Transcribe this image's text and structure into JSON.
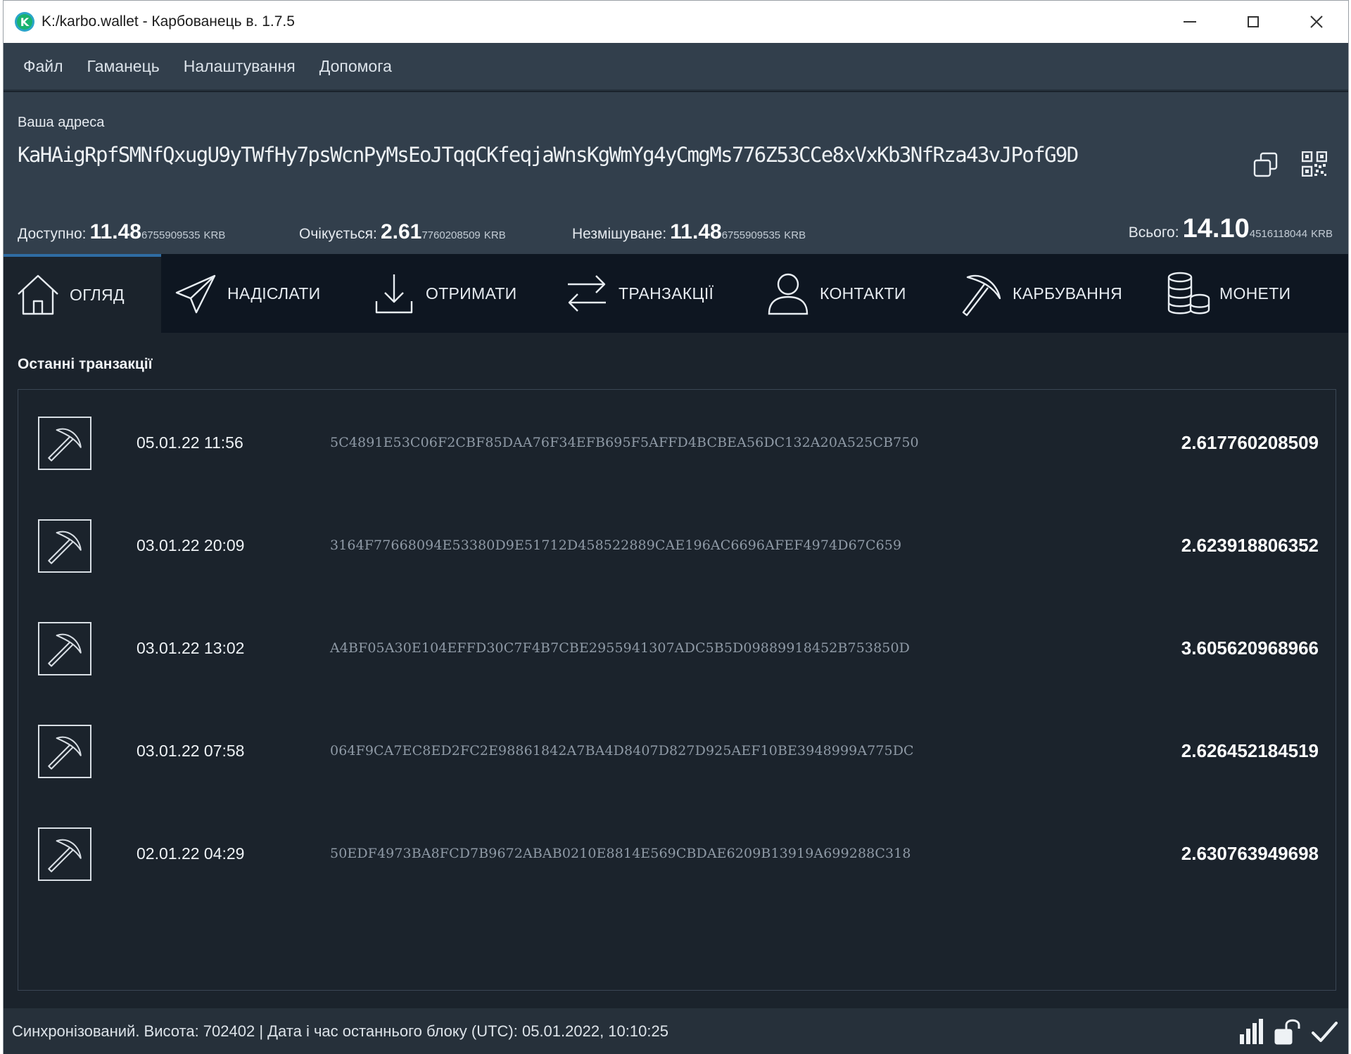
{
  "window": {
    "title": "K:/karbo.wallet - Карбованець в. 1.7.5",
    "logo_letter": "K"
  },
  "menu": [
    "Файл",
    "Гаманець",
    "Налаштування",
    "Допомога"
  ],
  "address": {
    "label": "Ваша адреса",
    "value": "KaHAigRpfSMNfQxugU9yTWfHy7psWcnPyMsEoJTqqCKfeqjaWnsKgWmYg4yCmgMs776Z53CCe8xVxKb3NfRza43vJPofG9D"
  },
  "balances": {
    "available": {
      "label": "Доступно:",
      "main": "11.48",
      "frac": "6755909535",
      "currency": "KRB"
    },
    "pending": {
      "label": "Очікується:",
      "main": "2.61",
      "frac": "7760208509",
      "currency": "KRB"
    },
    "unmixable": {
      "label": "Незмішуване:",
      "main": "11.48",
      "frac": "6755909535",
      "currency": "KRB"
    },
    "total": {
      "label": "Всього:",
      "main": "14.10",
      "frac": "4516118044",
      "currency": "KRB"
    }
  },
  "tabs": [
    {
      "label": "ОГЛЯД",
      "icon": "home-icon",
      "active": true
    },
    {
      "label": "НАДІСЛАТИ",
      "icon": "send-icon",
      "active": false
    },
    {
      "label": "ОТРИМАТИ",
      "icon": "receive-icon",
      "active": false
    },
    {
      "label": "ТРАНЗАКЦІЇ",
      "icon": "transactions-icon",
      "active": false
    },
    {
      "label": "КОНТАКТИ",
      "icon": "contacts-icon",
      "active": false
    },
    {
      "label": "КАРБУВАННЯ",
      "icon": "mining-icon",
      "active": false
    },
    {
      "label": "МОНЕТИ",
      "icon": "coins-icon",
      "active": false
    }
  ],
  "recent": {
    "title": "Останні транзакції",
    "transactions": [
      {
        "date": "05.01.22 11:56",
        "hash": "5C4891E53C06F2CBF85DAA76F34EFB695F5AFFD4BCBEA56DC132A20A525CB750",
        "amount": "2.617760208509"
      },
      {
        "date": "03.01.22 20:09",
        "hash": "3164F77668094E53380D9E51712D458522889CAE196AC6696AFEF4974D67C659",
        "amount": "2.623918806352"
      },
      {
        "date": "03.01.22 13:02",
        "hash": "A4BF05A30E104EFFD30C7F4B7CBE2955941307ADC5B5D09889918452B753850D",
        "amount": "3.605620968966"
      },
      {
        "date": "03.01.22 07:58",
        "hash": "064F9CA7EC8ED2FC2E98861842A7BA4D8407D827D925AEF10BE3948999A775DC",
        "amount": "2.626452184519"
      },
      {
        "date": "02.01.22 04:29",
        "hash": "50EDF4973BA8FCD7B9672ABAB0210E8814E569CBDAE6209B13919A699288C318",
        "amount": "2.630763949698"
      }
    ]
  },
  "status": {
    "text": "Синхронізований. Висота: 702402  |  Дата і час останнього блоку (UTC): 05.01.2022, 10:10:25",
    "icons": [
      "signal-bars-icon",
      "unlocked-padlock-icon",
      "checkmark-icon"
    ]
  },
  "colors": {
    "background": "#1b232c",
    "header": "#323f4c",
    "tabbar": "#0e1621",
    "active_tab_accent": "#2f6ca3"
  }
}
